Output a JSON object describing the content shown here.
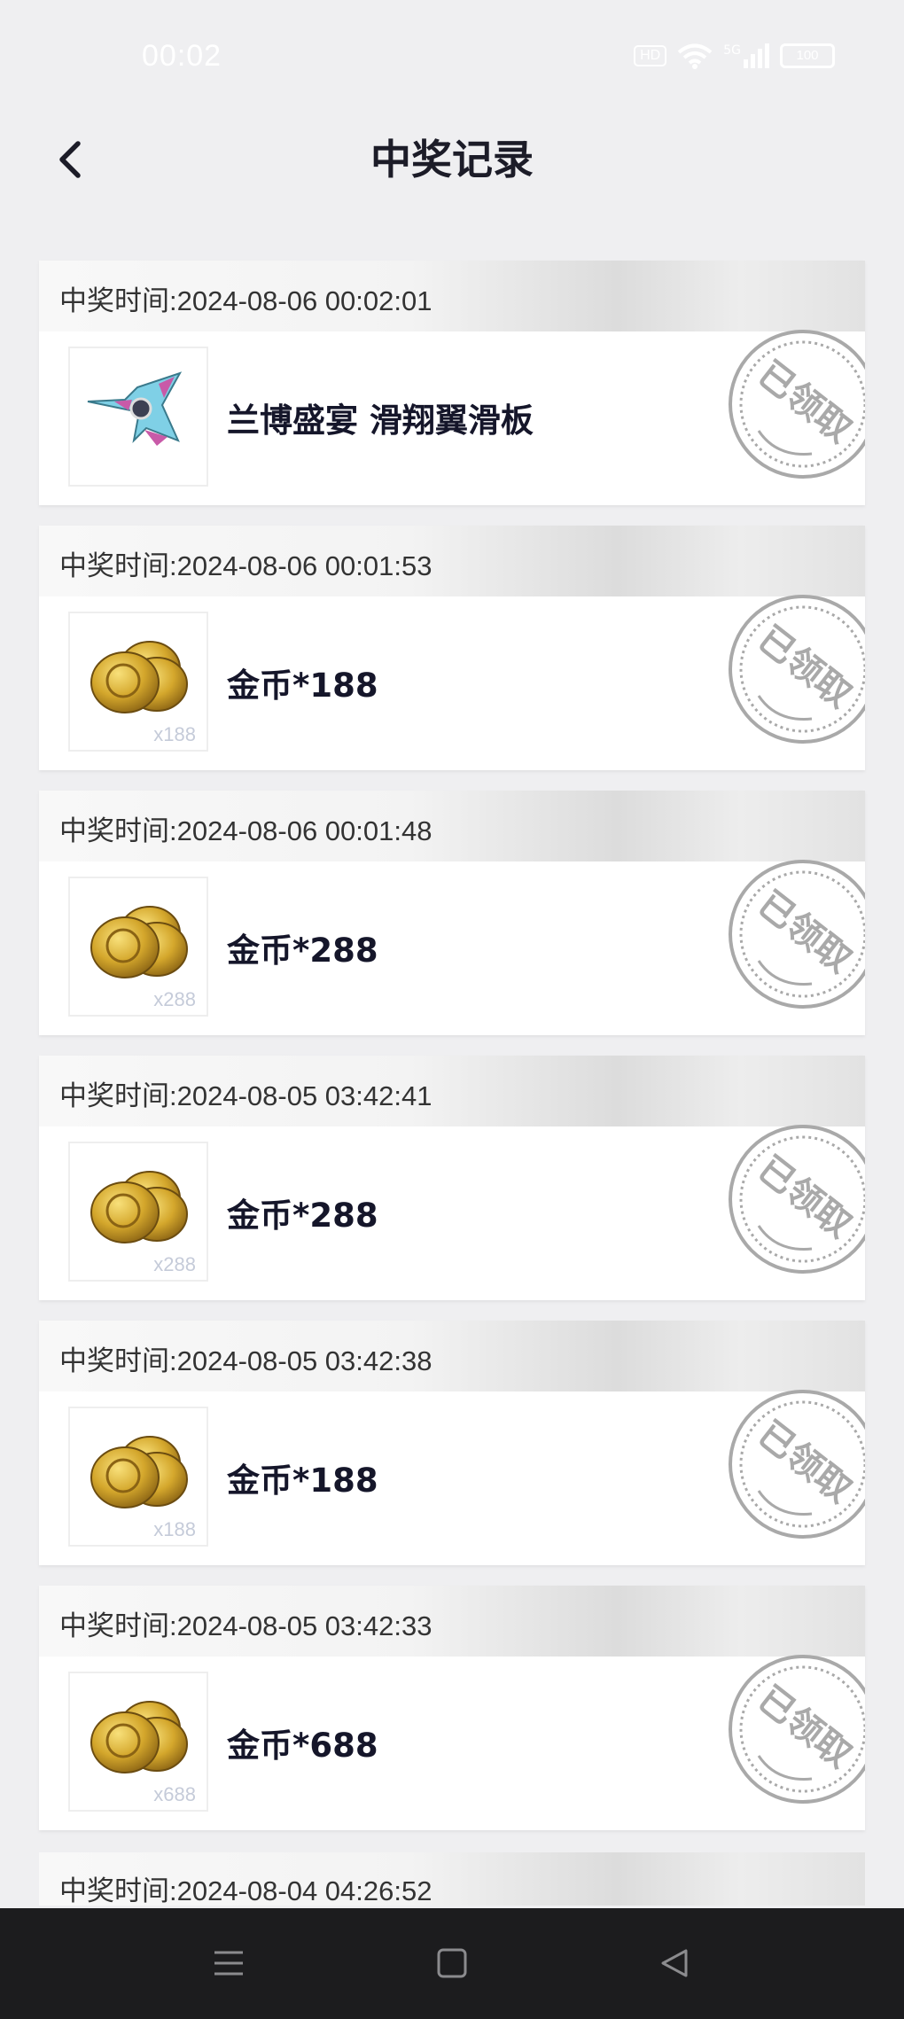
{
  "status_bar": {
    "time": "00:02",
    "icons": [
      "hd-icon",
      "wifi-icon",
      "5g-signal-icon",
      "battery-icon"
    ],
    "hd_label": "HD",
    "network_label": "5G",
    "battery": "100"
  },
  "header": {
    "title": "中奖记录",
    "back_icon": "chevron-left-icon"
  },
  "records": [
    {
      "time_label": "中奖时间:2024-08-06 00:02:01",
      "prize": "兰博盛宴 滑翔翼滑板",
      "thumb_type": "shuriken",
      "thumb_qty": "",
      "status": "已领取"
    },
    {
      "time_label": "中奖时间:2024-08-06 00:01:53",
      "prize": "金币*188",
      "thumb_type": "coins",
      "thumb_qty": "x188",
      "status": "已领取"
    },
    {
      "time_label": "中奖时间:2024-08-06 00:01:48",
      "prize": "金币*288",
      "thumb_type": "coins",
      "thumb_qty": "x288",
      "status": "已领取"
    },
    {
      "time_label": "中奖时间:2024-08-05 03:42:41",
      "prize": "金币*288",
      "thumb_type": "coins",
      "thumb_qty": "x288",
      "status": "已领取"
    },
    {
      "time_label": "中奖时间:2024-08-05 03:42:38",
      "prize": "金币*188",
      "thumb_type": "coins",
      "thumb_qty": "x188",
      "status": "已领取"
    },
    {
      "time_label": "中奖时间:2024-08-05 03:42:33",
      "prize": "金币*688",
      "thumb_type": "coins",
      "thumb_qty": "x688",
      "status": "已领取"
    },
    {
      "time_label": "中奖时间:2024-08-04 04:26:52"
    }
  ],
  "nav_bar": {
    "icons": [
      "menu-icon",
      "home-square-icon",
      "back-triangle-icon"
    ]
  },
  "colors": {
    "page_bg": "#efeff1",
    "card_bg": "#ffffff",
    "stamp": "#a9a9a9",
    "navbar_bg": "#1c1c1e"
  }
}
